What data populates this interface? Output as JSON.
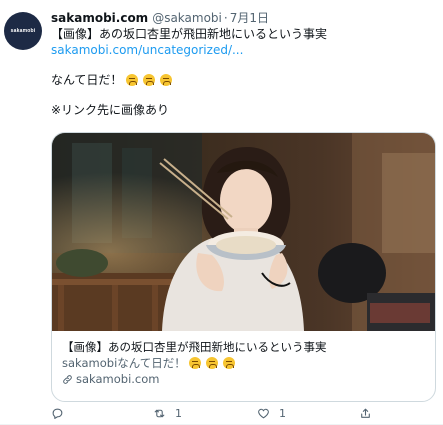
{
  "tweet": {
    "avatar_text": "sakamobi",
    "display_name": "sakamobi.com",
    "handle": "@sakamobi",
    "separator": "·",
    "date": "7月1日",
    "headline": "【画像】あの坂口杏里が飛田新地にいるという事実",
    "link_text": "sakamobi.com/uncategorized/...",
    "body_text": "なんて日だ！",
    "note": "※リンク先に画像あり"
  },
  "card": {
    "title": "【画像】あの坂口杏里が飛田新地にいるという事実",
    "description": "sakamobiなんて日だ！",
    "domain": "sakamobi.com"
  },
  "actions": {
    "reply_count": "",
    "retweet_count": "1",
    "like_count": "1"
  },
  "icons": [
    "reply-icon",
    "retweet-icon",
    "like-icon",
    "share-icon",
    "link-icon",
    "tired-face-emoji"
  ],
  "colors": {
    "link": "#1d9bf0",
    "text": "#0f1419",
    "muted": "#536471",
    "border": "#cfd9de",
    "emoji": "#f7c531"
  }
}
